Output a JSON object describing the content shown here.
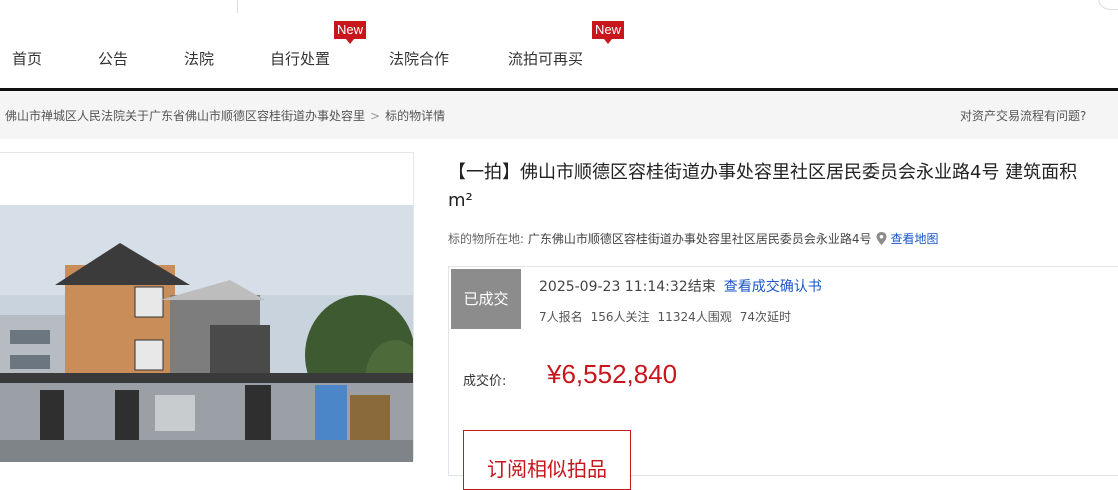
{
  "nav": {
    "items": [
      {
        "label": "首页",
        "badge": ""
      },
      {
        "label": "公告",
        "badge": ""
      },
      {
        "label": "法院",
        "badge": ""
      },
      {
        "label": "自行处置",
        "badge": "New"
      },
      {
        "label": "法院合作",
        "badge": ""
      },
      {
        "label": "流拍可再买",
        "badge": "New"
      }
    ]
  },
  "breadcrumb": {
    "parent": "佛山市禅城区人民法院关于广东省佛山市顺德区容桂街道办事处容里",
    "separator": ">",
    "current": "标的物详情"
  },
  "help_text": "对资产交易流程有问题?",
  "item": {
    "title": "【一拍】佛山市顺德区容桂街道办事处容里社区居民委员会永业路4号 建筑面积",
    "title_unit": "m²",
    "location_label": "标的物所在地:",
    "location_value": "广东佛山市顺德区容桂街道办事处容里社区居民委员会永业路4号",
    "map_link": "查看地图"
  },
  "auction": {
    "status": "已成交",
    "end_time": "2025-09-23 11:14:32结束",
    "confirm_link": "查看成交确认书",
    "stats": {
      "signups": "7人报名",
      "follows": "156人关注",
      "views": "11324人围观",
      "delays": "74次延时"
    },
    "price_label": "成交价:",
    "price": "¥6,552,840",
    "remind_button": "订阅相似拍品"
  },
  "colors": {
    "accent": "#c8161d",
    "link": "#1a56c8",
    "status_bg": "#8c8c8c"
  }
}
